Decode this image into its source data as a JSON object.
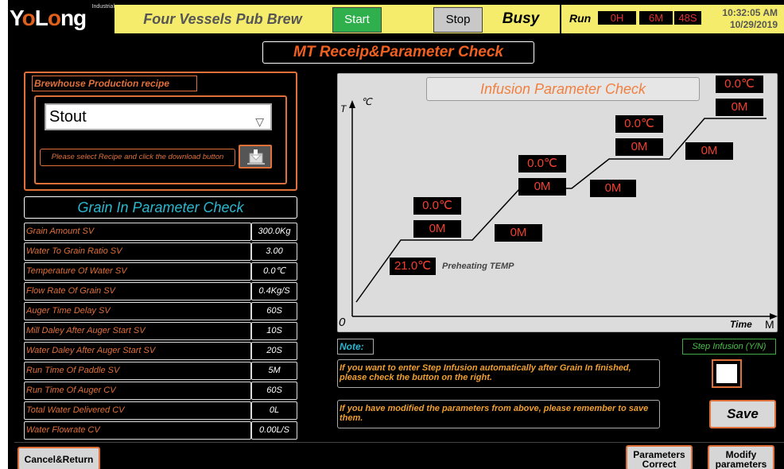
{
  "header": {
    "logo_text": "YoLong",
    "logo_sub": "Industrial",
    "plant_name": "Four Vessels Pub Brew",
    "start_label": "Start",
    "stop_label": "Stop",
    "status": "Busy",
    "run_label": "Run",
    "run_hours": "0H",
    "run_minutes": "6M",
    "run_seconds": "48S",
    "time": "10:32:05 AM",
    "date": "10/29/2019"
  },
  "page_title": "MT Receip&Parameter Check",
  "recipe": {
    "section_title": "Brewhouse Production recipe",
    "selected": "Stout",
    "hint": "Please select Recipe and click the download button"
  },
  "grain": {
    "section_title": "Grain In Parameter Check",
    "rows": [
      {
        "label": "Grain Amount SV",
        "value": "300.0Kg"
      },
      {
        "label": "Water To Grain Ratio SV",
        "value": "3.00"
      },
      {
        "label": "Temperature Of Water SV",
        "value": "0.0℃"
      },
      {
        "label": "Flow Rate Of Grain SV",
        "value": "0.4Kg/S"
      },
      {
        "label": "Auger Time Delay  SV",
        "value": "60S"
      },
      {
        "label": "Mill Daley After Auger Start SV",
        "value": "10S"
      },
      {
        "label": "Water Daley After Auger Start SV",
        "value": "20S"
      },
      {
        "label": "Run Time Of Paddle SV",
        "value": "5M"
      },
      {
        "label": "Run Time Of Auger CV",
        "value": "60S"
      },
      {
        "label": "Total Water Delivered CV",
        "value": "0L"
      },
      {
        "label": "Water Flowrate CV",
        "value": "0.00L/S"
      }
    ]
  },
  "infusion": {
    "title": "Infusion Parameter Check",
    "y_axis_t": "T",
    "y_axis_unit": "℃",
    "origin": "0",
    "x_axis_label": "Time",
    "x_axis_unit": "M",
    "preheat_temp": "21.0℃",
    "preheat_label": "Preheating TEMP",
    "steps": [
      {
        "temp": "0.0℃",
        "hold": "0M",
        "ramp": "0M"
      },
      {
        "temp": "0.0℃",
        "hold": "0M",
        "ramp": "0M"
      },
      {
        "temp": "0.0℃",
        "hold": "0M",
        "ramp": "0M"
      },
      {
        "temp": "0.0℃",
        "hold": "0M"
      }
    ]
  },
  "note": {
    "label": "Note:",
    "message1": "If you want to enter Step Infusion automatically after Grain In finished, please check the button on the right.",
    "message2": "If you have modified the parameters from above, please remember to save them.",
    "step_infusion_label": "Step Infusion (Y/N)",
    "step_infusion_checked": false,
    "save_label": "Save"
  },
  "footer": {
    "cancel_label": "Cancel&Return",
    "params_correct_label": "Parameters Correct",
    "modify_params_label": "Modify parameters"
  },
  "colors": {
    "header_yellow": "#f4ec6a",
    "accent_orange": "#e0703a",
    "title_orange": "#f06020",
    "cyan": "#2ab8d0",
    "start_green": "#2fb04c",
    "value_red": "#f04030"
  }
}
